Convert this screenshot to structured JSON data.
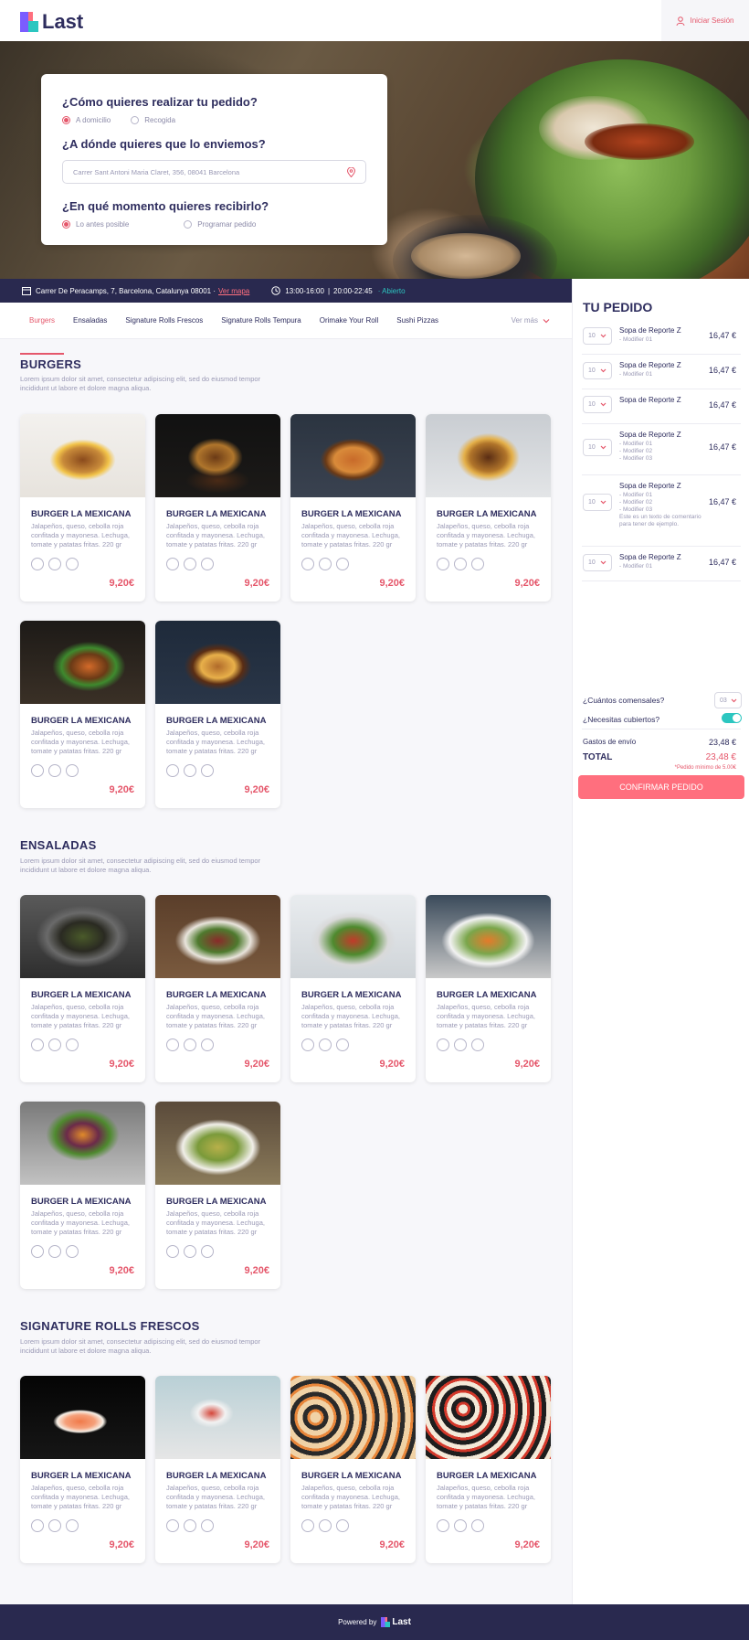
{
  "header": {
    "brand": "Last",
    "login": "Iniciar Sesión"
  },
  "order_form": {
    "q1": "¿Cómo quieres realizar tu pedido?",
    "q1_options": [
      "A domicilio",
      "Recogida"
    ],
    "q2": "¿A dónde quieres que lo enviemos?",
    "address": "Carrer Sant Antoni Maria Claret, 356, 08041 Barcelona",
    "q3": "¿En qué momento quieres recibirlo?",
    "q3_options": [
      "Lo antes posible",
      "Programar pedido"
    ]
  },
  "info_bar": {
    "address": "Carrer De Peracamps, 7, Barcelona, Catalunya 08001 ·",
    "map_link": "Ver mapa",
    "hours1": "13:00-16:00",
    "separator": "|",
    "hours2": "20:00-22:45",
    "status": "· Abierto"
  },
  "categories": [
    "Burgers",
    "Ensaladas",
    "Signature Rolls Frescos",
    "Signature Rolls Tempura",
    "Orimake Your Roll",
    "Sushi Pizzas"
  ],
  "more_label": "Ver más",
  "sections": [
    {
      "title": "BURGERS",
      "desc": "Lorem ipsum dolor sit amet, consectetur adipiscing elit, sed do eiusmod tempor incididunt ut labore et dolore magna aliqua."
    },
    {
      "title": "ENSALADAS",
      "desc": "Lorem ipsum dolor sit amet, consectetur adipiscing elit, sed do eiusmod tempor incididunt ut labore et dolore magna aliqua."
    },
    {
      "title": "SIGNATURE ROLLS FRESCOS",
      "desc": "Lorem ipsum dolor sit amet, consectetur adipiscing elit, sed do eiusmod tempor incididunt ut labore et dolore magna aliqua."
    }
  ],
  "product": {
    "name": "BURGER LA MEXICANA",
    "desc": "Jalapeños, queso, cebolla roja confitada y mayonesa. Lechuga, tomate y patatas fritas. 220 gr",
    "price": "9,20€"
  },
  "cart": {
    "title": "TU PEDIDO",
    "items": [
      {
        "qty": "10",
        "name": "Sopa de Reporte Z",
        "mods": "- Modifier 01",
        "price": "16,47 €"
      },
      {
        "qty": "10",
        "name": "Sopa de Reporte Z",
        "mods": "- Modifier 01",
        "price": "16,47 €"
      },
      {
        "qty": "10",
        "name": "Sopa de Reporte Z",
        "mods": "",
        "price": "16,47 €"
      },
      {
        "qty": "10",
        "name": "Sopa de Reporte Z",
        "mods": "- Modifier 01\n- Modifier 02\n- Modifier 03",
        "price": "16,47 €"
      },
      {
        "qty": "10",
        "name": "Sopa de Reporte Z",
        "mods": "- Modifier 01\n- Modifier 02\n- Modifier 03\nEste es un texto de comentario para tener de ejemplo.",
        "price": "16,47 €"
      },
      {
        "qty": "10",
        "name": "Sopa de Reporte Z",
        "mods": "- Modifier 01",
        "price": "16,47 €"
      }
    ],
    "guests_label": "¿Cuántos comensales?",
    "guests_value": "03",
    "cutlery_label": "¿Necesitas cubiertos?",
    "shipping_label": "Gastos de envío",
    "shipping_value": "23,48 €",
    "total_label": "TOTAL",
    "total_value": "23,48 €",
    "min_note": "*Pedido mínimo de 5.00€",
    "confirm_label": "CONFIRMAR PEDIDO"
  },
  "footer": {
    "powered": "Powered by",
    "brand": "Last"
  }
}
